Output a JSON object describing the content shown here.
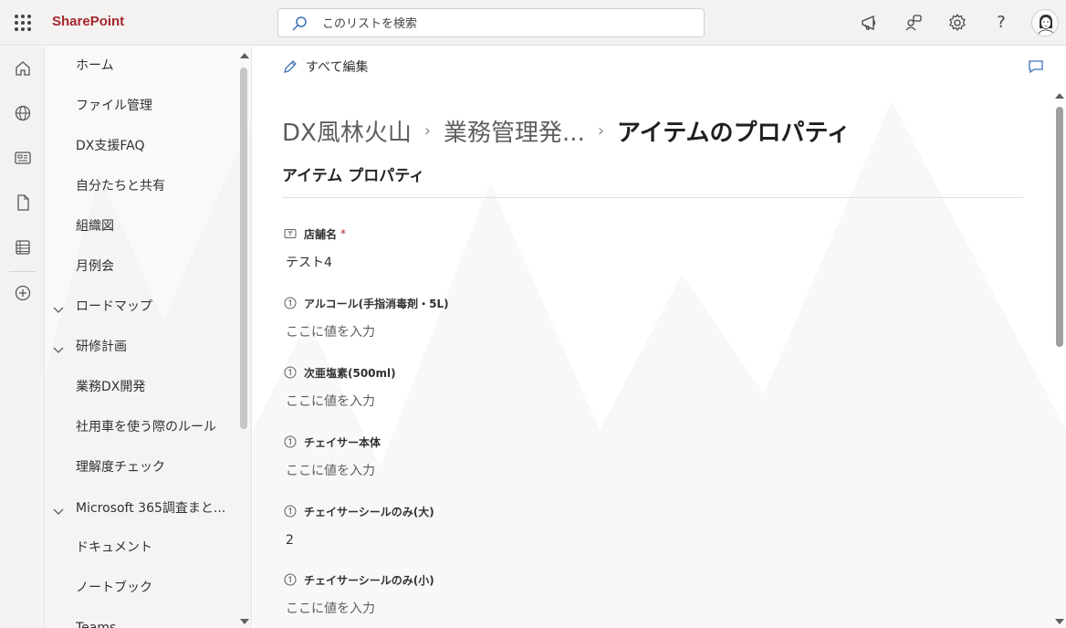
{
  "topbar": {
    "app_name": "SharePoint",
    "search_placeholder": "このリストを検索",
    "help_label": "?",
    "icons": [
      "app-launcher-icon",
      "megaphone-icon",
      "people-connect-icon",
      "gear-icon",
      "help-icon"
    ]
  },
  "rail": {
    "icons": [
      "home-icon",
      "globe-icon",
      "news-icon",
      "file-icon",
      "list-icon",
      "add-icon"
    ]
  },
  "nav": {
    "items": [
      {
        "label": "ホーム",
        "expandable": false
      },
      {
        "label": "ファイル管理",
        "expandable": false
      },
      {
        "label": "DX支援FAQ",
        "expandable": false
      },
      {
        "label": "自分たちと共有",
        "expandable": false
      },
      {
        "label": "組織図",
        "expandable": false
      },
      {
        "label": "月例会",
        "expandable": false
      },
      {
        "label": "ロードマップ",
        "expandable": true
      },
      {
        "label": "研修計画",
        "expandable": true
      },
      {
        "label": "業務DX開発",
        "expandable": false
      },
      {
        "label": "社用車を使う際のルール",
        "expandable": false
      },
      {
        "label": "理解度チェック",
        "expandable": false
      },
      {
        "label": "Microsoft 365調査まと...",
        "expandable": true
      },
      {
        "label": "ドキュメント",
        "expandable": false
      },
      {
        "label": "ノートブック",
        "expandable": false
      },
      {
        "label": "Teams",
        "expandable": false
      }
    ]
  },
  "main": {
    "edit_all_label": "すべて編集",
    "breadcrumb": {
      "site": "DX風林火山",
      "list": "業務管理発...",
      "current": "アイテムのプロパティ",
      "separator": "›"
    },
    "section_title": "アイテム プロパティ",
    "fields": [
      {
        "label": "店舗名",
        "required": true,
        "required_mark": "*",
        "icon": "text-field-icon",
        "value": "テスト4",
        "is_placeholder": false
      },
      {
        "label": "アルコール(手指消毒剤・5L)",
        "required": false,
        "icon": "number-field-icon",
        "value": "ここに値を入力",
        "is_placeholder": true
      },
      {
        "label": "次亜塩素(500ml)",
        "required": false,
        "icon": "number-field-icon",
        "value": "ここに値を入力",
        "is_placeholder": true
      },
      {
        "label": "チェイサー本体",
        "required": false,
        "icon": "number-field-icon",
        "value": "ここに値を入力",
        "is_placeholder": true
      },
      {
        "label": "チェイサーシールのみ(大)",
        "required": false,
        "icon": "number-field-icon",
        "value": "2",
        "is_placeholder": false
      },
      {
        "label": "チェイサーシールのみ(小)",
        "required": false,
        "icon": "number-field-icon",
        "value": "ここに値を入力",
        "is_placeholder": true
      }
    ]
  },
  "colors": {
    "brand": "#a4262c",
    "chrome_bg": "#f3f2f1",
    "nav_bg": "#faf9f8",
    "text": "#323130",
    "placeholder": "#605e5c"
  }
}
